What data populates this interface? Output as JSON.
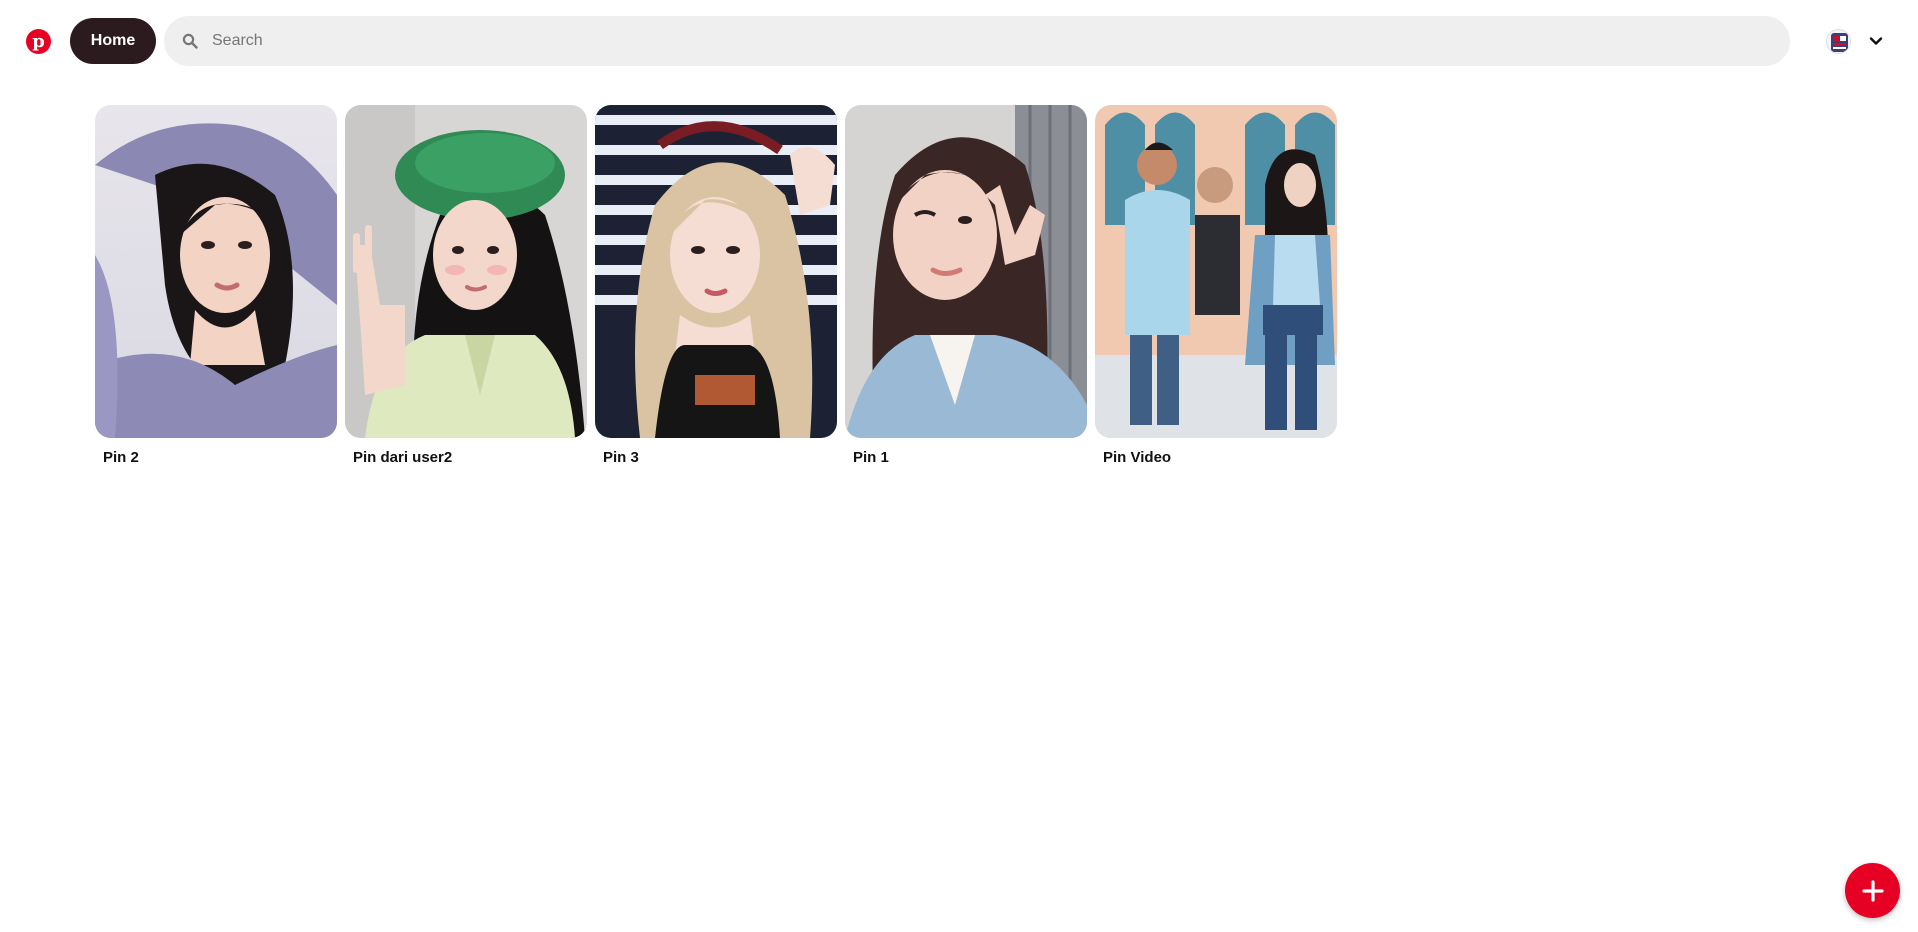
{
  "header": {
    "logo": "p",
    "home_label": "Home",
    "search_placeholder": "Search",
    "search_value": ""
  },
  "pins": [
    {
      "title": "Pin 2",
      "scene": "portrait-lavender"
    },
    {
      "title": "Pin dari user2",
      "scene": "portrait-green-beret"
    },
    {
      "title": "Pin 3",
      "scene": "portrait-blonde"
    },
    {
      "title": "Pin 1",
      "scene": "portrait-wink"
    },
    {
      "title": "Pin Video",
      "scene": "street-group"
    }
  ],
  "colors": {
    "brand": "#e60023",
    "home_button": "#2b1b1f",
    "search_bg": "#efefef"
  },
  "icons": {
    "logo": "pinterest-logo-icon",
    "search": "search-icon",
    "avatar": "avatar-icon",
    "menu": "chevron-down-icon",
    "create": "plus-icon"
  }
}
